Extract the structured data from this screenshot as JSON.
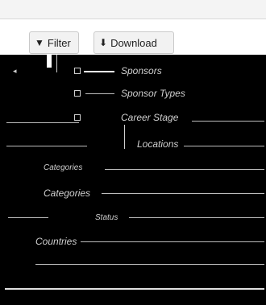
{
  "toolbar": {
    "filter_label": "Filter",
    "download_label": "Download"
  },
  "menu": {
    "items": [
      {
        "label": "Sponsors"
      },
      {
        "label": "Sponsor Types"
      },
      {
        "label": "Career Stage"
      },
      {
        "label": "Locations"
      },
      {
        "label": "Categories"
      },
      {
        "label": "Categories"
      },
      {
        "label": "Status"
      },
      {
        "label": "Countries"
      }
    ]
  }
}
